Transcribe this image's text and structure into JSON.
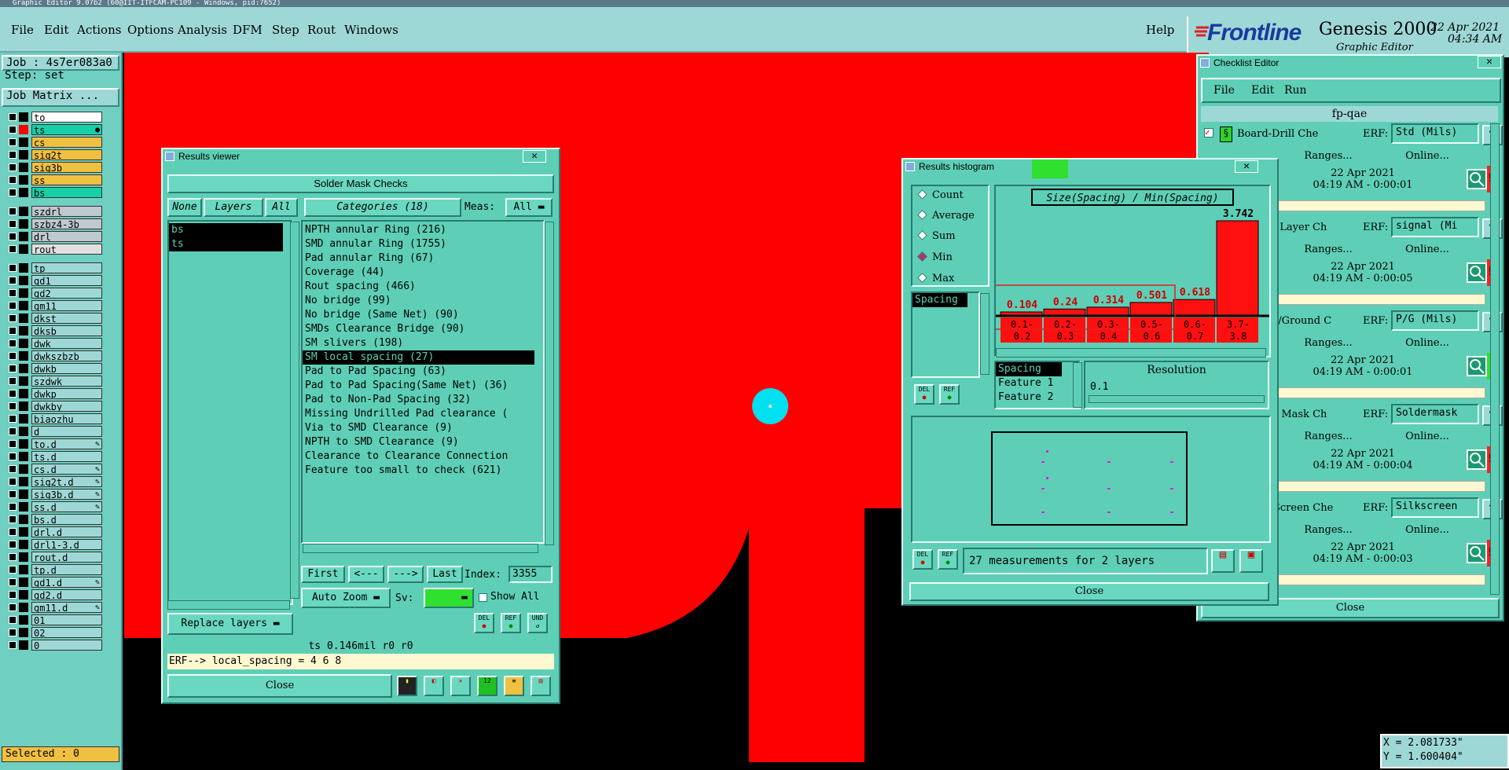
{
  "window_title": "Graphic Editor 9.07b2 (60@IIT-ITFCAM-PC109 - Windows, pid:7652)",
  "menu": [
    "File",
    "Edit",
    "Actions",
    "Options",
    "Analysis",
    "DFM",
    "Step",
    "Rout",
    "Windows"
  ],
  "help_label": "Help",
  "brand": {
    "logo": "Frontline",
    "product": "Genesis 2000",
    "subtitle": "Graphic Editor",
    "date": "22 Apr 2021",
    "time": "04:34 AM"
  },
  "left_panel": {
    "job": "Job : 4s7er083a0",
    "step": "Step: set",
    "job_matrix": "Job Matrix ...",
    "layers_group1": [
      "to",
      "ts",
      "cs",
      "sig2t",
      "sig3b",
      "ss",
      "bs"
    ],
    "layers_group2": [
      "szdrl",
      "szbz4-3b",
      "drl",
      "rout"
    ],
    "layers_group3": [
      "tp",
      "gd1",
      "gd2",
      "gm11",
      "dkst",
      "dksb",
      "dwk",
      "dwkszbzb",
      "dwkb",
      "szdwk",
      "dwkp",
      "dwkby",
      "biaozhu",
      "d",
      "to.d",
      "ts.d",
      "cs.d",
      "sig2t.d",
      "sig3b.d",
      "ss.d",
      "bs.d",
      "drl.d",
      "drl1-3.d",
      "rout.d",
      "tp.d",
      "gd1.d",
      "gd2.d",
      "gm11.d",
      "01",
      "02",
      "0"
    ],
    "selected": "Selected : 0"
  },
  "coords": {
    "x": "X = 2.081733\"",
    "y": "Y = 1.600404\""
  },
  "results_viewer": {
    "title": "Results viewer",
    "header": "Solder Mask Checks",
    "none_label": "None",
    "layers_label": "Layers",
    "all_label": "All",
    "categories_label": "Categories (18)",
    "meas_label": "Meas:",
    "meas_value": "All",
    "layers": [
      "bs",
      "ts"
    ],
    "categories": [
      "NPTH annular Ring (216)",
      "SMD annular Ring (1755)",
      "Pad annular Ring (67)",
      "Coverage (44)",
      "Rout spacing (466)",
      "No bridge (99)",
      "No bridge (Same Net) (90)",
      "SMDs Clearance Bridge (90)",
      "SM slivers (198)",
      "SM local spacing (27)",
      "Pad to Pad Spacing (63)",
      "Pad to Pad Spacing(Same Net) (36)",
      "Pad to Non-Pad Spacing (32)",
      "Missing Undrilled Pad clearance (",
      "Via to SMD Clearance (9)",
      "NPTH to SMD Clearance (9)",
      "Clearance to Clearance Connection",
      "Feature too small to check (621)"
    ],
    "selected_category_index": 9,
    "first": "First",
    "prev": "<---",
    "next": "--->",
    "last": "Last",
    "index_label": "Index:",
    "index_value": "3355",
    "auto_zoom": "Auto Zoom",
    "sv_label": "Sv:",
    "show_all": "Show All",
    "replace_layers": "Replace layers",
    "status_line": "ts 0.146mil  r0  r0",
    "erf_line": "ERF--> local_spacing = 4 6 8",
    "close": "Close"
  },
  "histogram": {
    "title": "Results histogram",
    "chart_title": "Size(Spacing) / Min(Spacing)",
    "modes": [
      "Count",
      "Average",
      "Sum",
      "Min",
      "Max"
    ],
    "selected_mode": "Min",
    "attribute": "Spacing",
    "attr_list": [
      "Spacing",
      "Feature 1",
      "Feature 2"
    ],
    "resolution_label": "Resolution",
    "resolution_value": "0.1",
    "bins": [
      {
        "top": "0.1-",
        "bottom": "0.2",
        "value": 0.104,
        "label": "0.104"
      },
      {
        "top": "0.2-",
        "bottom": "0.3",
        "value": 0.24,
        "label": "0.24"
      },
      {
        "top": "0.3-",
        "bottom": "0.4",
        "value": 0.314,
        "label": "0.314"
      },
      {
        "top": "0.5-",
        "bottom": "0.6",
        "value": 0.501,
        "label": "0.501"
      },
      {
        "top": "0.6-",
        "bottom": "0.7",
        "value": 0.618,
        "label": "0.618"
      },
      {
        "top": "3.7-",
        "bottom": "3.8",
        "value": 3.742,
        "label": "3.742"
      }
    ],
    "status": "27 measurements for 2 layers",
    "close": "Close"
  },
  "checklist": {
    "title": "Checklist Editor",
    "menu": [
      "File",
      "Edit",
      "Run"
    ],
    "name": "fp-qae",
    "erf_label": "ERF:",
    "ranges": "Ranges...",
    "online": "Online...",
    "close": "Close",
    "rows": [
      {
        "name": "Board-Drill Che",
        "erf": "Std (Mils)",
        "date": "22 Apr 2021",
        "time": "04:19 AM - 0:00:01",
        "status": "!!"
      },
      {
        "name": "l Layer Ch",
        "erf": "signal (Mi",
        "date": "22 Apr 2021",
        "time": "04:19 AM - 0:00:05",
        "status": "!!"
      },
      {
        "name": "r/Ground C",
        "erf": "P/G (Mils)",
        "date": "22 Apr 2021",
        "time": "04:19 AM - 0:00:01",
        "status": ""
      },
      {
        "name": "r Mask Ch",
        "erf": "Soldermask",
        "date": "22 Apr 2021",
        "time": "04:19 AM - 0:00:04",
        "status": "!!"
      },
      {
        "name": "Screen Che",
        "erf": "Silkscreen",
        "date": "22 Apr 2021",
        "time": "04:19 AM - 0:00:03",
        "status": "!!"
      }
    ]
  }
}
